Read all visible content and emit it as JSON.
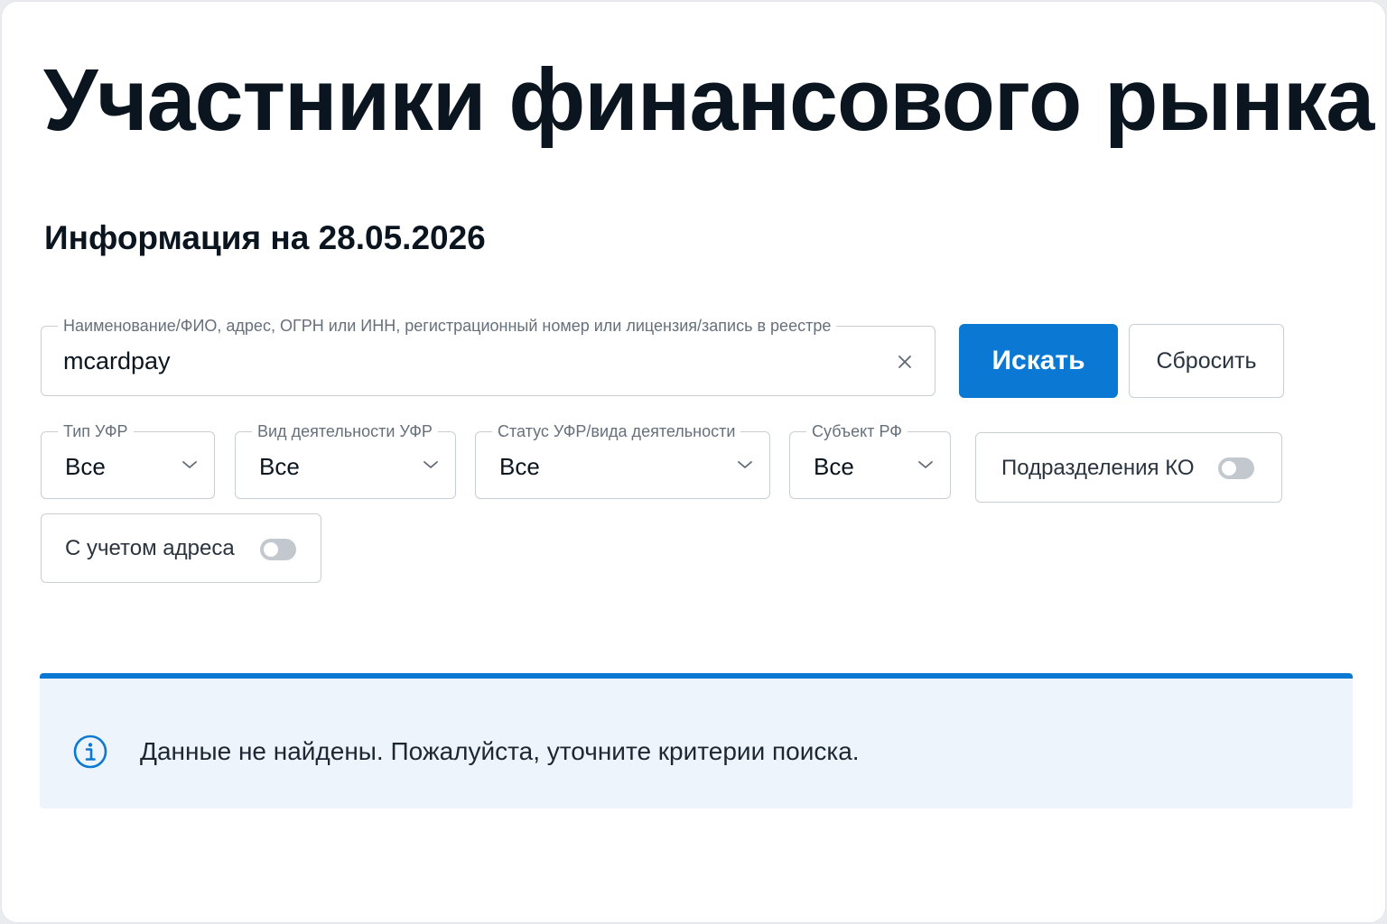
{
  "page": {
    "title": "Участники финансового рынка",
    "info_date": "Информация на 28.05.2026"
  },
  "search": {
    "label": "Наименование/ФИО, адрес, ОГРН или ИНН, регистрационный номер или лицензия/запись в реестре",
    "value": "mcardpay",
    "clear_icon": "close-icon"
  },
  "buttons": {
    "search_label": "Искать",
    "reset_label": "Сбросить"
  },
  "filters": [
    {
      "label": "Тип УФР",
      "value": "Все"
    },
    {
      "label": "Вид деятельности УФР",
      "value": "Все"
    },
    {
      "label": "Статус УФР/вида деятельности",
      "value": "Все"
    },
    {
      "label": "Субъект РФ",
      "value": "Все"
    }
  ],
  "toggles": {
    "ko": {
      "label": "Подразделения КО",
      "on": false
    },
    "address": {
      "label": "С учетом адреса",
      "on": false
    }
  },
  "alert": {
    "text": "Данные не найдены. Пожалуйста, уточните критерии поиска.",
    "icon": "info-icon"
  },
  "colors": {
    "accent": "#0b79d3",
    "alert_bg": "#eef4fb",
    "text": "#0b1520",
    "border": "#c9ced5"
  }
}
